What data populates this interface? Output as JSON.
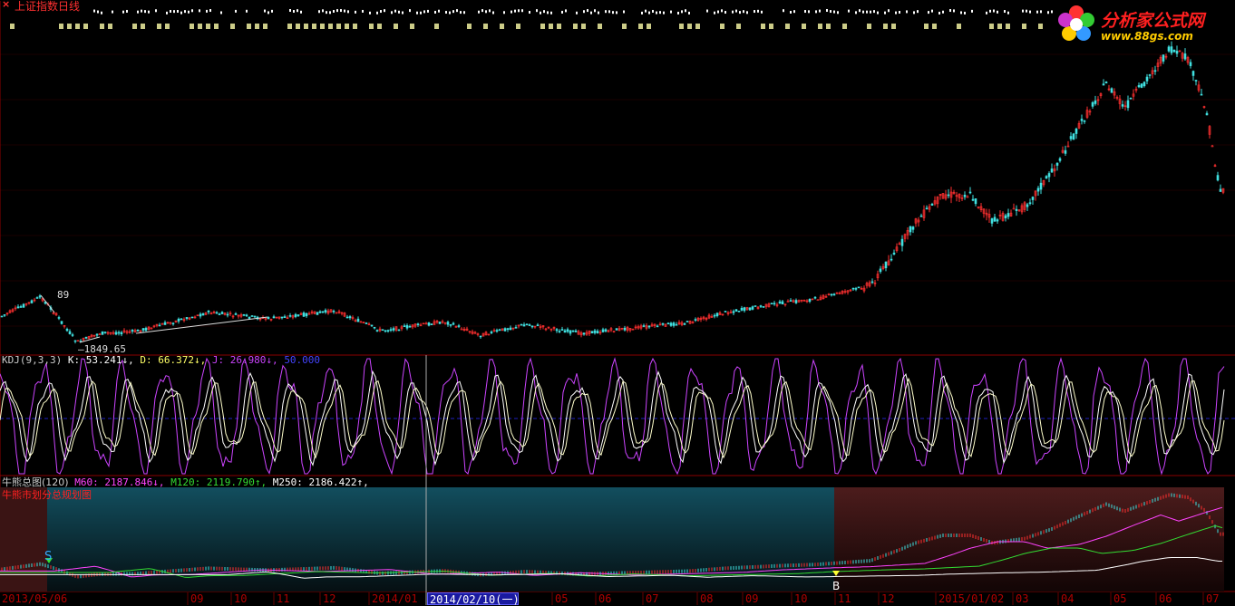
{
  "window": {
    "title": "上证指数日线"
  },
  "logo": {
    "name": "分析家公式网",
    "url": "www.88gs.com"
  },
  "price_panel": {
    "high_marker": "89",
    "low_marker": "1849.65"
  },
  "kdj_panel": {
    "name": "KDJ(9,3,3)",
    "k_label": "K: 53.241↓,",
    "d_label": "D: 66.372↓,",
    "j_label": "J: 26.980↓,",
    "ref_label": "50.000",
    "colors": {
      "k": "#ffffff",
      "d": "#ffffff",
      "j": "#cc44ff",
      "ref": "#2020ff"
    }
  },
  "bull_bear_panel": {
    "name": "牛熊总图(120)",
    "m60_label": "M60: 2187.846↓,",
    "m120_label": "M120: 2119.790↑,",
    "m250_label": "M250: 2186.422↑,",
    "subtitle": "牛熊市划分总规划图",
    "sell_marker": "S",
    "buy_marker": "B",
    "colors": {
      "m60": "#ff44ff",
      "m120": "#33dd33",
      "m250": "#ffffff",
      "bear_zone": "#0e4a5a",
      "bull_zone": "#4a1a1a"
    }
  },
  "time_axis": {
    "labels": [
      "2013/05/06",
      "09",
      "10",
      "11",
      "12",
      "2014/01",
      "2014/02/10(一)",
      "05",
      "06",
      "07",
      "08",
      "09",
      "10",
      "11",
      "12",
      "2015/01/02",
      "03",
      "04",
      "05",
      "06",
      "07"
    ],
    "cursor_label": "2014/02/10(一)"
  }
}
